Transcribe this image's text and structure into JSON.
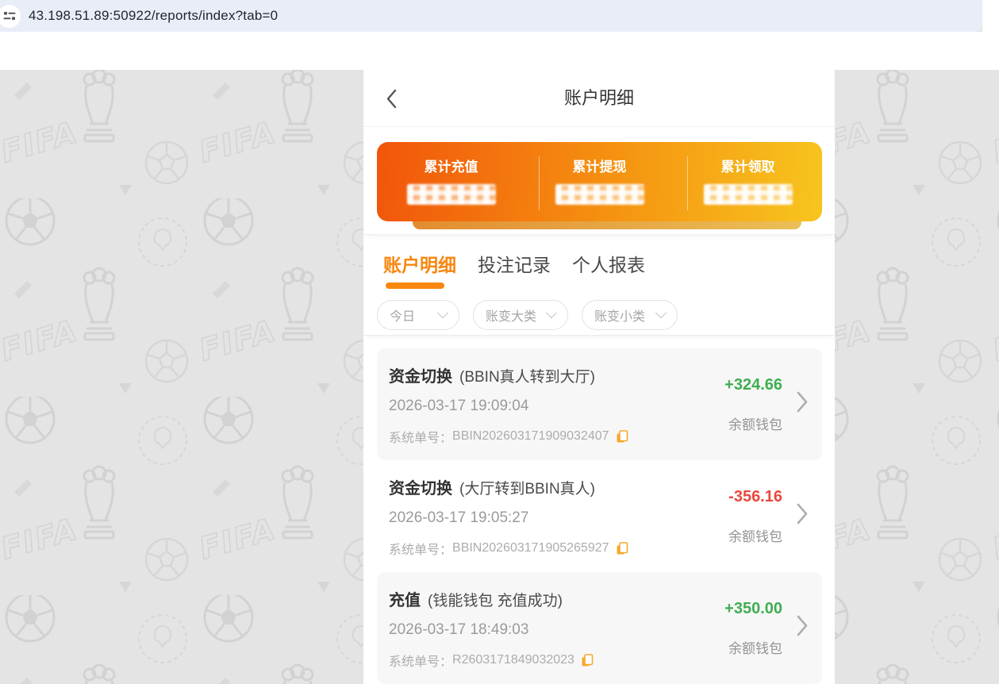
{
  "browser": {
    "url": "43.198.51.89:50922/reports/index?tab=0",
    "icon": "site-settings-icon"
  },
  "header": {
    "title": "账户明细"
  },
  "summary": {
    "cards": [
      {
        "label": "累计充值",
        "value_masked": true
      },
      {
        "label": "累计提现",
        "value_masked": true
      },
      {
        "label": "累计领取",
        "value_masked": true
      }
    ]
  },
  "tabs": [
    {
      "label": "账户明细",
      "active": true
    },
    {
      "label": "投注记录",
      "active": false
    },
    {
      "label": "个人报表",
      "active": false
    }
  ],
  "filters": [
    {
      "label": "今日",
      "icon": "chevron-down-icon"
    },
    {
      "label": "账变大类",
      "icon": "chevron-down-icon"
    },
    {
      "label": "账变小类",
      "icon": "chevron-down-icon"
    }
  ],
  "transactions": [
    {
      "type": "资金切换",
      "detail": "(BBIN真人转到大厅)",
      "datetime": "2026-03-17 19:09:04",
      "order_label": "系统单号：",
      "order_no": "BBIN202603171909032407",
      "amount": "+324.66",
      "direction": "positive",
      "wallet": "余额钱包"
    },
    {
      "type": "资金切换",
      "detail": "(大厅转到BBIN真人)",
      "datetime": "2026-03-17 19:05:27",
      "order_label": "系统单号：",
      "order_no": "BBIN202603171905265927",
      "amount": "-356.16",
      "direction": "negative",
      "wallet": "余额钱包"
    },
    {
      "type": "充值",
      "detail": "(钱能钱包 充值成功)",
      "datetime": "2026-03-17 18:49:03",
      "order_label": "系统单号：",
      "order_no": "R2603171849032023",
      "amount": "+350.00",
      "direction": "positive",
      "wallet": "余额钱包"
    }
  ],
  "colors": {
    "accent_orange": "#f8870f",
    "card_gradient_start": "#f1550b",
    "card_gradient_end": "#f7c51e",
    "positive": "#3fae50",
    "negative": "#e9483f",
    "topbar_bg": "#e9edf8",
    "page_bg": "#e4e4e4",
    "row_alt_bg": "#f7f7f8"
  }
}
